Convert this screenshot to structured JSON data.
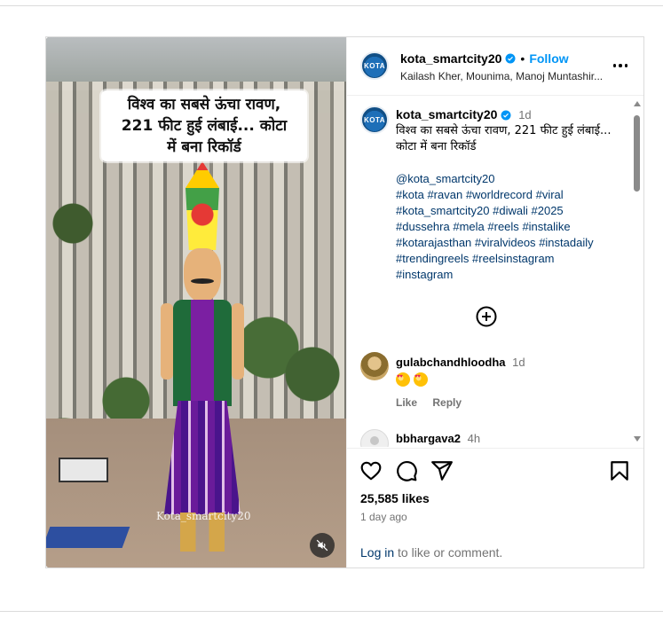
{
  "media": {
    "headline_line1": "विश्व का सबसे ऊंचा रावण,",
    "headline_line2": "221 फीट हुई लंबाई... कोटा",
    "headline_line3": "में बना रिकॉर्ड",
    "watermark": "Kota_smartcity20",
    "mute_icon": "speaker-muted-icon"
  },
  "header": {
    "avatar_text": "KOTA",
    "username": "kota_smartcity20",
    "separator": "•",
    "follow_label": "Follow",
    "subtitle": "Kailash Kher, Mounima, Manoj Muntashir...",
    "more_icon": "more-horizontal-icon"
  },
  "caption": {
    "avatar_text": "KOTA",
    "username": "kota_smartcity20",
    "time": "1d",
    "text": "विश्व का सबसे ऊंचा रावण, 221 फीट हुई लंबाई... कोटा में बना रिकॉर्ड",
    "mention": "@kota_smartcity20",
    "hashtags": [
      "#kota",
      "#ravan",
      "#worldrecord",
      "#viral",
      "#kota_smartcity20",
      "#diwali",
      "#2025",
      "#dussehra",
      "#mela",
      "#reels",
      "#instalike",
      "#kotarajasthan",
      "#viralvideos",
      "#instadaily",
      "#trendingreels",
      "#reelsinstagram",
      "#instagram"
    ]
  },
  "comments": [
    {
      "username": "gulabchandhloodha",
      "time": "1d",
      "like_label": "Like",
      "reply_label": "Reply",
      "emoji": "smiling-face-with-heart-eyes"
    },
    {
      "username": "bbhargava2",
      "time": "4h"
    }
  ],
  "footer": {
    "likes": "25,585 likes",
    "ago": "1 day ago",
    "login_link": "Log in",
    "login_rest": " to like or comment."
  },
  "colors": {
    "link": "#00376b",
    "follow": "#0095f6",
    "verified": "#0095f6",
    "muted": "#737373",
    "border": "#dbdbdb"
  }
}
